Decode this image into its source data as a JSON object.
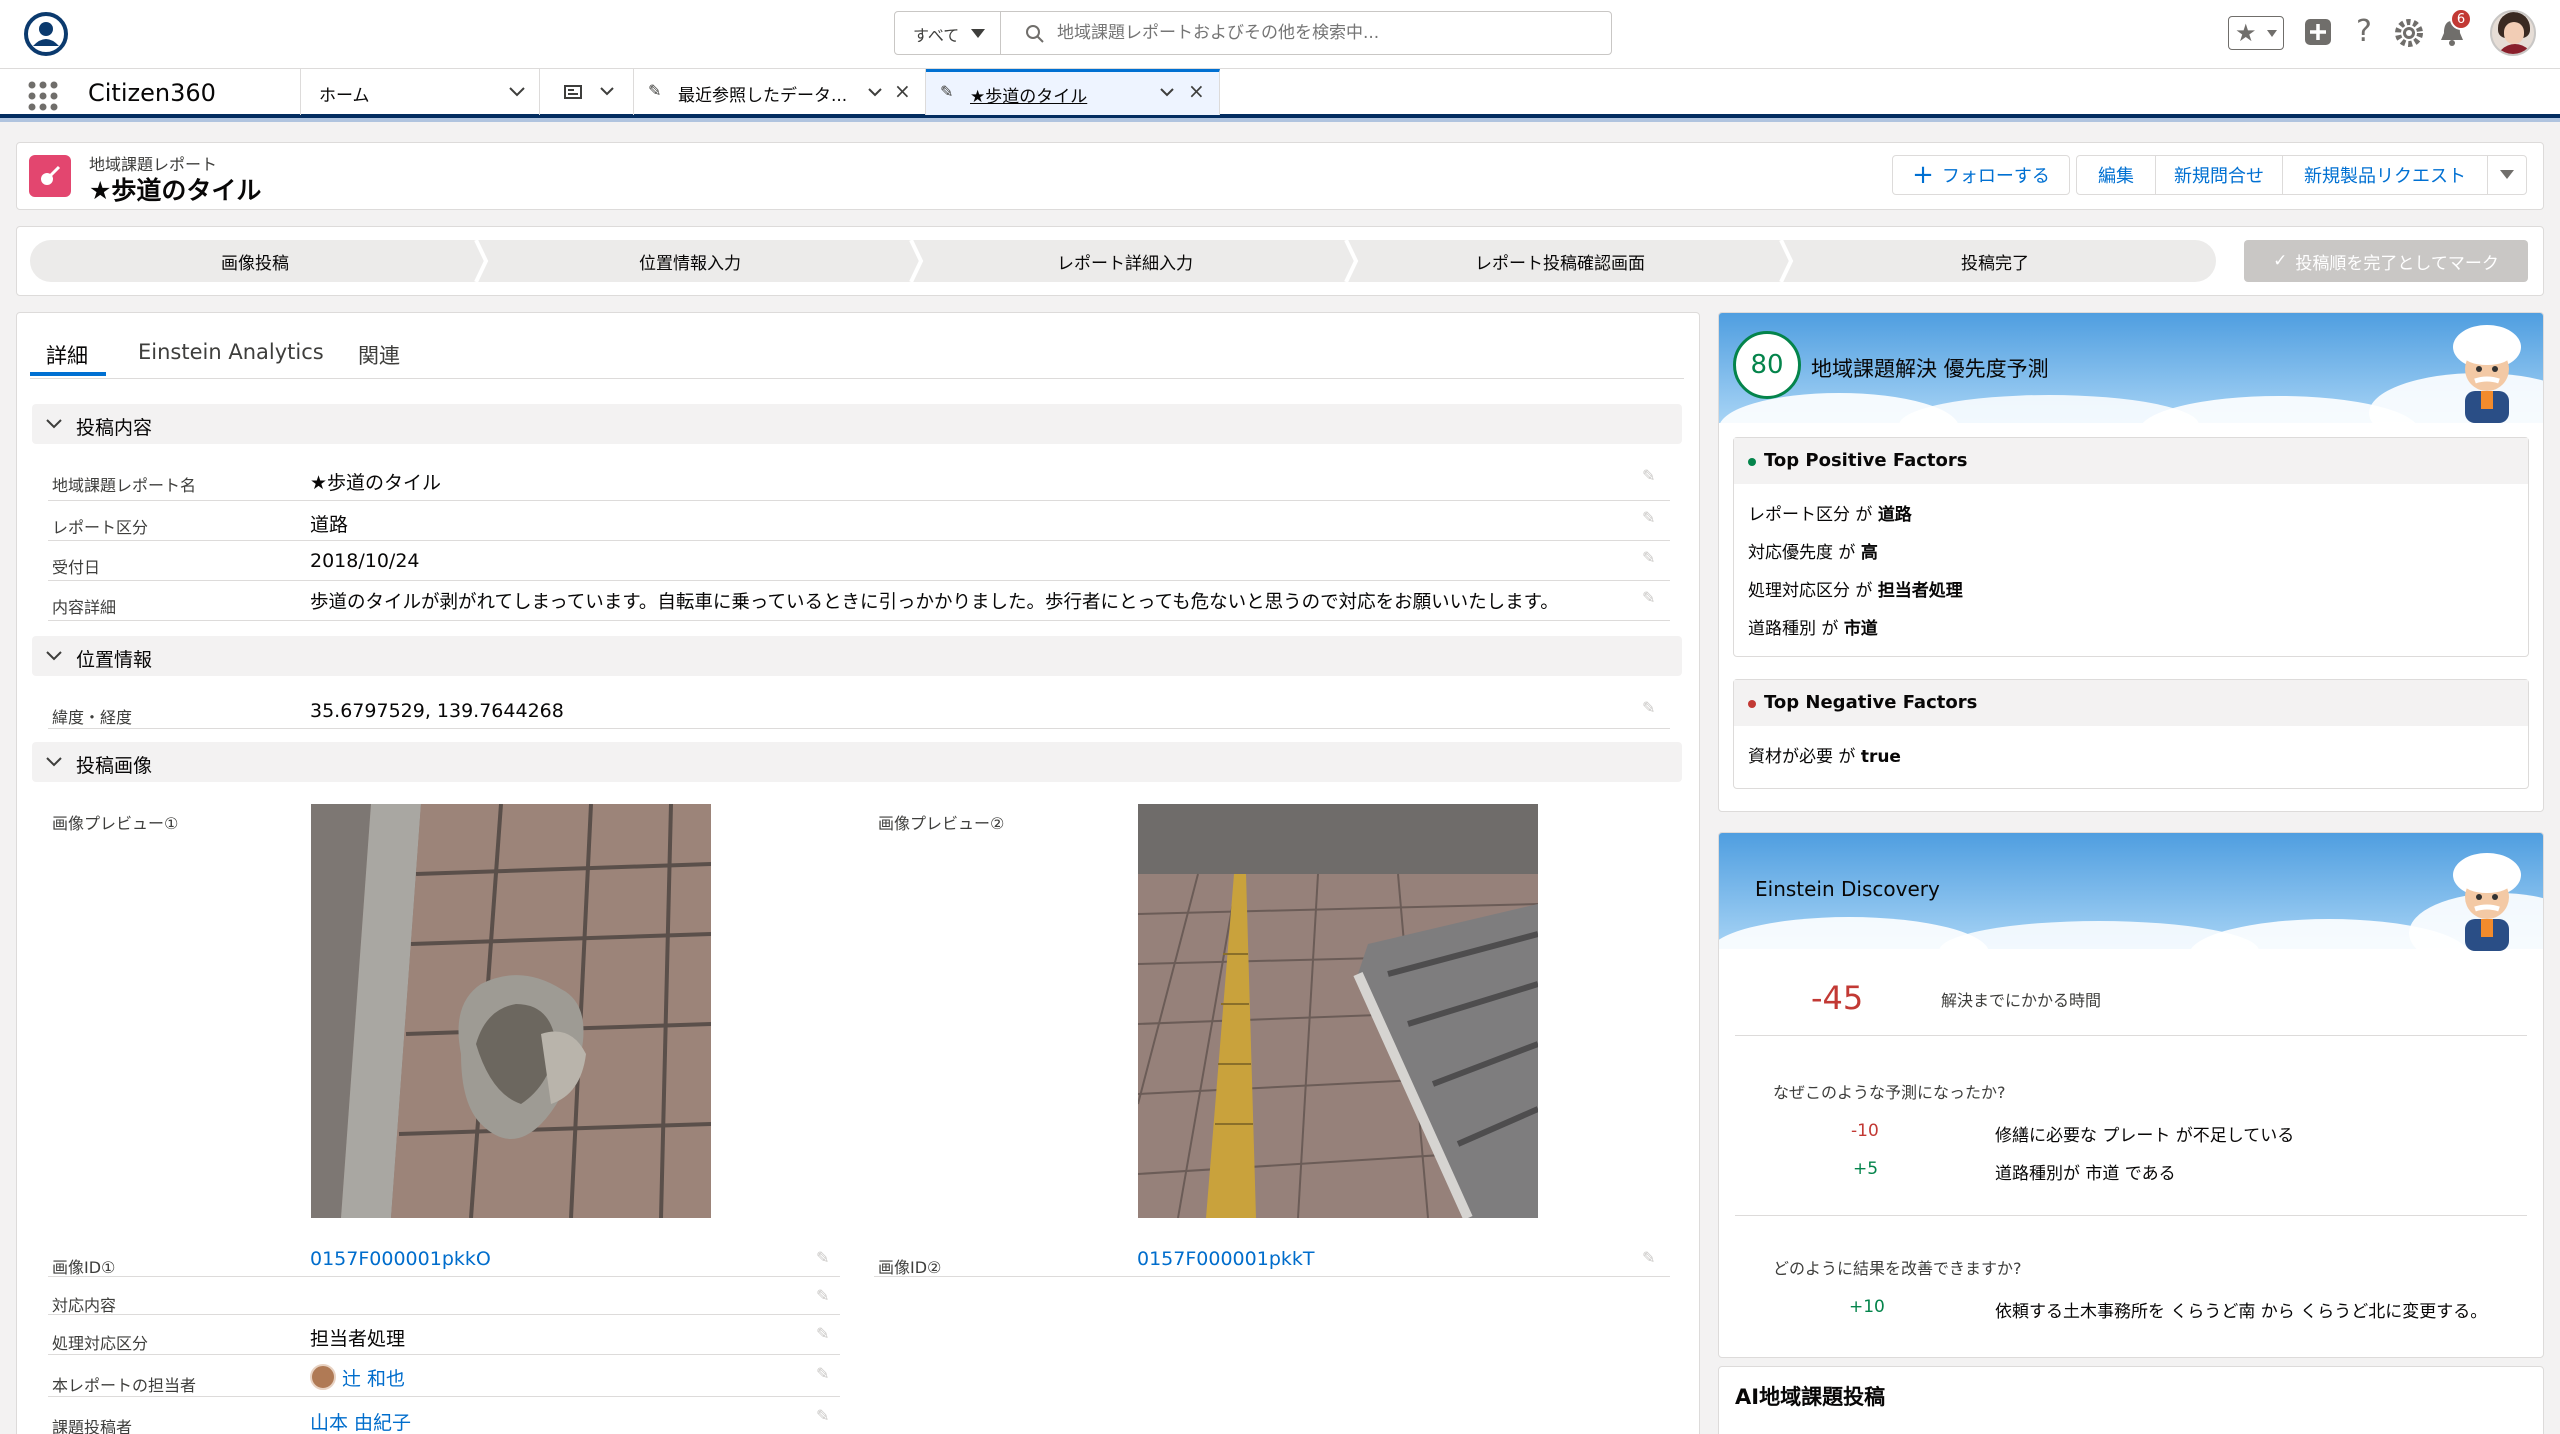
{
  "header": {
    "search_scope": "すべて",
    "search_placeholder": "地域課題レポートおよびその他を検索中...",
    "notification_count": "6"
  },
  "nav": {
    "app_name": "Citizen360",
    "home_tab": "ホーム",
    "recent_tab": "最近参照したデータ...",
    "active_tab": "★歩道のタイル"
  },
  "record": {
    "object_label": "地域課題レポート",
    "title": "★歩道のタイル",
    "actions": {
      "follow": "フォローする",
      "edit": "編集",
      "new_inquiry": "新規問合せ",
      "new_product_request": "新規製品リクエスト"
    }
  },
  "path": {
    "steps": [
      "画像投稿",
      "位置情報入力",
      "レポート詳細入力",
      "レポート投稿確認画面",
      "投稿完了"
    ],
    "mark_button": "投稿順を完了としてマーク"
  },
  "detail": {
    "tabs": [
      "詳細",
      "Einstein Analytics",
      "関連"
    ],
    "sections": {
      "post": "投稿内容",
      "location": "位置情報",
      "images": "投稿画像"
    },
    "fields": {
      "report_name_label": "地域課題レポート名",
      "report_name": "★歩道のタイル",
      "category_label": "レポート区分",
      "category": "道路",
      "received_label": "受付日",
      "received": "2018/10/24",
      "content_label": "内容詳細",
      "content": "歩道のタイルが剥がれてしまっています。自転車に乗っているときに引っかかりました。歩行者にとっても危ないと思うので対応をお願いいたします。",
      "latlng_label": "緯度・経度",
      "latlng": "35.6797529, 139.7644268",
      "preview1_label": "画像プレビュー①",
      "preview2_label": "画像プレビュー②",
      "image_id1_label": "画像ID①",
      "image_id1": "0157F000001pkkO",
      "image_id2_label": "画像ID②",
      "image_id2": "0157F000001pkkT",
      "action_label": "対応内容",
      "handling_label": "処理対応区分",
      "handling": "担当者処理",
      "owner_label": "本レポートの担当者",
      "owner": "辻 和也",
      "poster_label": "課題投稿者",
      "poster": "山本 由紀子"
    }
  },
  "priority": {
    "score": "80",
    "title": "地域課題解決 優先度予測",
    "positive_title": "Top Positive Factors",
    "positive": [
      {
        "k": "レポート区分",
        "op": "が",
        "v": "道路"
      },
      {
        "k": "対応優先度",
        "op": "が",
        "v": "高"
      },
      {
        "k": "処理対応区分",
        "op": "が",
        "v": "担当者処理"
      },
      {
        "k": "道路種別",
        "op": "が",
        "v": "市道"
      }
    ],
    "negative_title": "Top Negative Factors",
    "negative": [
      {
        "k": "資材が必要",
        "op": "が",
        "v": "true"
      }
    ]
  },
  "discovery": {
    "title": "Einstein Discovery",
    "value": "-45",
    "value_label": "解決までにかかる時間",
    "why_title": "なぜこのような予測になったか?",
    "why": [
      {
        "n": "-10",
        "t": "修繕に必要な プレート が不足している"
      },
      {
        "n": "+5",
        "t": "道路種別が 市道 である"
      }
    ],
    "improve_title": "どのように結果を改善できますか?",
    "improve": [
      {
        "n": "+10",
        "t": "依頼する土木事務所を くらうど南 から くらうど北に変更する。"
      }
    ]
  },
  "ai_card": {
    "title": "AI地域課題投稿"
  },
  "colors": {
    "brand_dark": "#032d60",
    "link": "#006dcc",
    "positive": "#04844b",
    "negative": "#c23934",
    "record_icon": "#e3466f"
  }
}
